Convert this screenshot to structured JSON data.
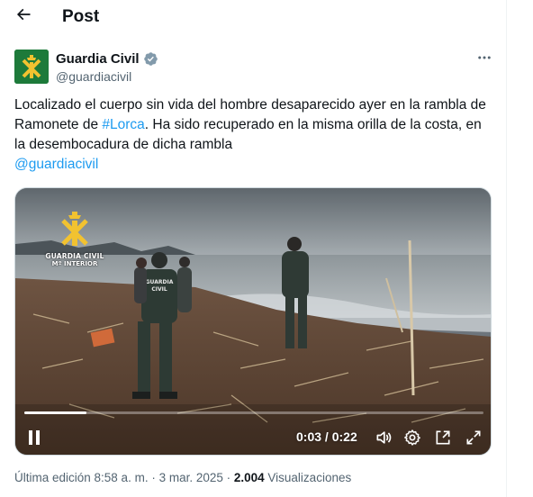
{
  "header": {
    "title": "Post",
    "back_icon": "arrow-left-icon"
  },
  "author": {
    "name": "Guardia Civil",
    "handle": "@guardiacivil",
    "verified_color": "#829aab",
    "avatar_color": "#1d7a3a"
  },
  "tweet": {
    "text_part1": "Localizado el cuerpo sin vida del hombre desaparecido ayer en la rambla de Ramonete de ",
    "hashtag": "#Lorca",
    "text_part2": ". Ha sido recuperado en la misma orilla de la costa, en la desembocadura de dicha rambla",
    "mention": "@guardiacivil",
    "link_color": "#1d9bf0"
  },
  "video": {
    "watermark_line1": "GUARDIA CIVIL",
    "watermark_line2": "Mº INTERIOR",
    "vest_text_1": "GUARDIA",
    "vest_text_2": "CIVIL",
    "current_time": "0:03",
    "separator": " / ",
    "duration": "0:22",
    "progress_fraction": 0.136
  },
  "meta": {
    "edited_label": "Última edición 8:58 a. m. · 3 mar. 2025 · ",
    "views_count": "2.004",
    "views_label": " Visualizaciones"
  }
}
